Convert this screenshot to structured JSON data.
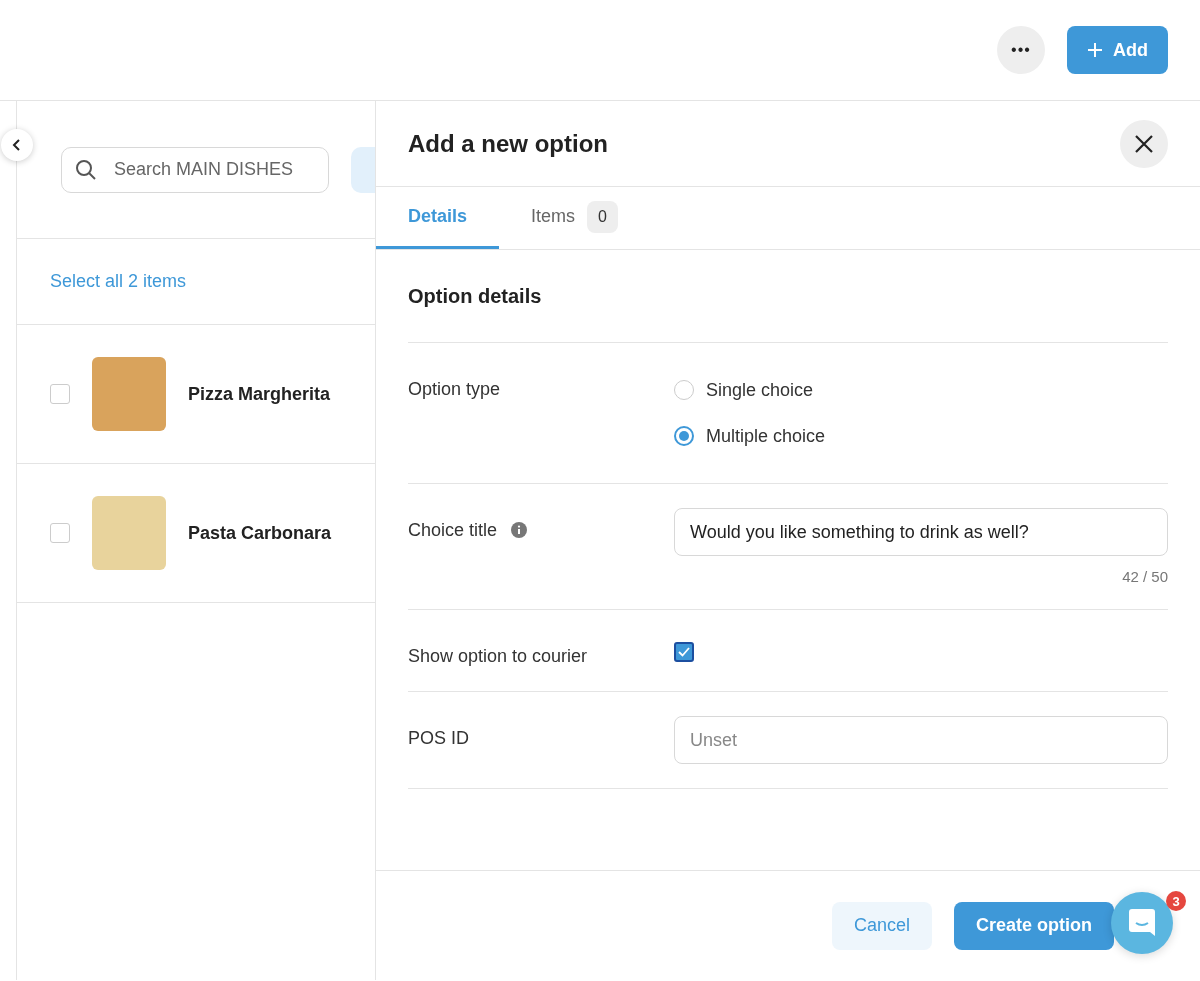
{
  "top_bar": {
    "more_label": "•••",
    "add_button": "Add"
  },
  "list": {
    "search": {
      "placeholder": "Search MAIN DISHES"
    },
    "select_all": "Select all 2 items",
    "items": [
      {
        "name": "Pizza Margherita",
        "checked": false
      },
      {
        "name": "Pasta Carbonara",
        "checked": false
      }
    ]
  },
  "panel": {
    "title": "Add a new option",
    "tabs": [
      {
        "label": "Details",
        "selected": true
      },
      {
        "label": "Items",
        "selected": false,
        "count": "0"
      }
    ],
    "section_title": "Option details",
    "fields": [
      {
        "kind": "radio",
        "label": "Option type",
        "options": [
          {
            "label": "Single choice",
            "selected": false
          },
          {
            "label": "Multiple choice",
            "selected": true
          }
        ]
      },
      {
        "kind": "text",
        "label": "Choice title",
        "info": true,
        "value": "Would you like something to drink as well?",
        "counter": "42 / 50"
      },
      {
        "kind": "checkbox",
        "label": "Show option to courier",
        "checked": true
      },
      {
        "kind": "text",
        "label": "POS ID",
        "info": false,
        "placeholder": "Unset"
      }
    ],
    "footer": {
      "cancel": "Cancel",
      "create": "Create option"
    }
  },
  "chat": {
    "badge": "3"
  }
}
